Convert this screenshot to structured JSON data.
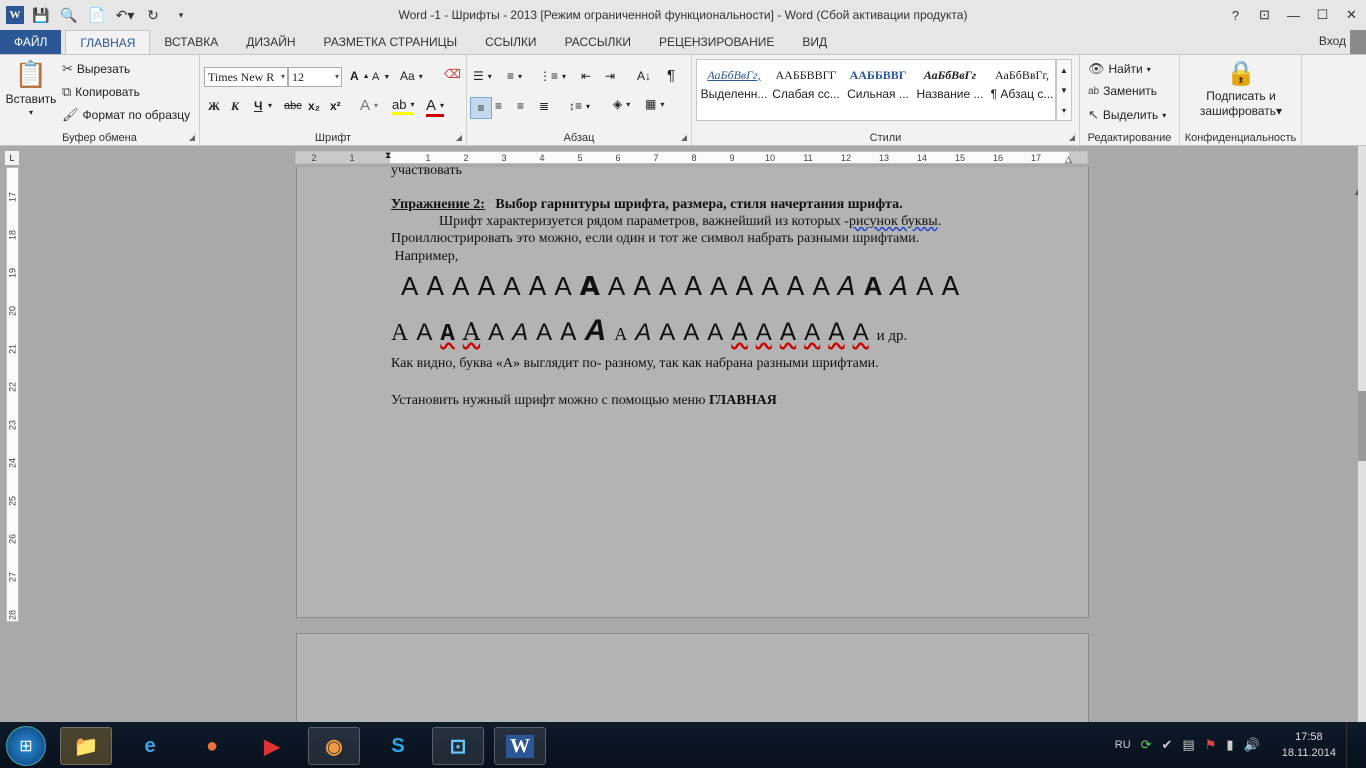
{
  "titlebar": {
    "title": "Word -1 - Шрифты - 2013 [Режим ограниченной функциональности] - Word (Сбой активации продукта)",
    "help": "?",
    "ribbon_display": "⊡",
    "minimize": "—",
    "maximize": "☐",
    "close": "✕",
    "qat": [
      "word-logo",
      "save",
      "print-preview",
      "new",
      "undo",
      "redo",
      "customize"
    ]
  },
  "tabs": [
    "ФАЙЛ",
    "ГЛАВНАЯ",
    "ВСТАВКА",
    "ДИЗАЙН",
    "РАЗМЕТКА СТРАНИЦЫ",
    "ССЫЛКИ",
    "РАССЫЛКИ",
    "РЕЦЕНЗИРОВАНИЕ",
    "ВИД"
  ],
  "active_tab": "ГЛАВНАЯ",
  "signin": "Вход",
  "ribbon": {
    "clipboard": {
      "paste": "Вставить",
      "cut": "Вырезать",
      "copy": "Копировать",
      "format_painter": "Формат по образцу",
      "label": "Буфер обмена"
    },
    "font": {
      "family": "Times New R",
      "size": "12",
      "bold": "Ж",
      "italic": "К",
      "underline": "Ч",
      "strike": "abc",
      "subscript": "x₂",
      "superscript": "x²",
      "grow": "A",
      "shrink": "A",
      "case": "Aa",
      "label": "Шрифт"
    },
    "paragraph": {
      "label": "Абзац",
      "show_marks": "¶"
    },
    "styles": {
      "label": "Стили",
      "items": [
        {
          "preview": "АаБбВвГг,",
          "name": "Выделенн..."
        },
        {
          "preview": "ААББВВГГ",
          "name": "Слабая сс..."
        },
        {
          "preview": "ААББВВГ",
          "name": "Сильная ..."
        },
        {
          "preview": "АаБбВвГг",
          "name": "Название ..."
        },
        {
          "preview": "АаБбВвГг,",
          "name": "¶ Абзац с..."
        }
      ]
    },
    "editing": {
      "find": "Найти",
      "replace": "Заменить",
      "select": "Выделить",
      "label": "Редактирование"
    },
    "privacy": {
      "sign": "Подписать и",
      "encrypt": "зашифровать",
      "label": "Конфиденциальность"
    }
  },
  "ruler": {
    "h_ticks": [
      "2",
      "1",
      "1",
      "2",
      "3",
      "4",
      "5",
      "6",
      "7",
      "8",
      "9",
      "10",
      "11",
      "12",
      "13",
      "14",
      "15",
      "16",
      "17"
    ],
    "v_ticks": [
      "17",
      "18",
      "19",
      "20",
      "21",
      "22",
      "23",
      "24",
      "25",
      "26",
      "27",
      "28"
    ]
  },
  "document": {
    "line0": "участвовать",
    "exercise_label": "Упражнение 2:",
    "exercise_title": "Выбор гарнитуры шрифта, размера, стиля начертания шрифта.",
    "p1_a": "Шрифт характеризуется рядом параметров, важнейший из которых -",
    "p1_b": "рисунок  буквы",
    "p1_c": ".",
    "p2": "Проиллюстрировать это можно, если один и тот же символ набрать разными шрифтами.",
    "p3": " Например,",
    "row1_glyph": "A",
    "row1_count": 22,
    "row2_glyph": "A",
    "row2_tail": "и др.",
    "p4": "Как видно, буква «А» выглядит по- разному, так как набрана разными шрифтами.",
    "p5_a": "Установить нужный шрифт можно с помощью меню ",
    "p5_b": "ГЛАВНАЯ"
  },
  "taskbar": {
    "apps": [
      "explorer",
      "internet-explorer",
      "firefox",
      "video",
      "chrome",
      "skype",
      "network-app",
      "word"
    ],
    "lang": "RU",
    "time": "17:58",
    "date": "18.11.2014"
  }
}
